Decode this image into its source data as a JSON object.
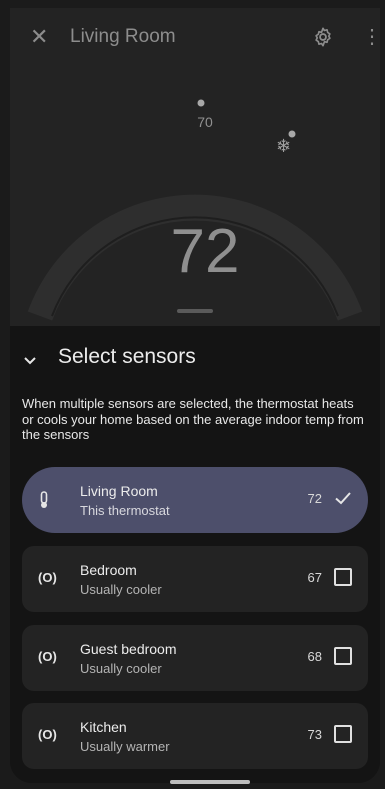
{
  "header": {
    "title": "Living Room",
    "close_icon": "close-icon",
    "settings_icon": "gear-icon",
    "more_icon": "more-vert-icon"
  },
  "thermostat": {
    "set_temp": "70",
    "current_temp": "72",
    "mode_icon": "snowflake-icon",
    "mode_glyph": "❄"
  },
  "sensors": {
    "title": "Select sensors",
    "description": "When multiple sensors are selected, the thermostat heats or cools your home based on the average indoor temp from the sensors",
    "items": [
      {
        "name": "Living Room",
        "subtitle": "This thermostat",
        "temp": "72",
        "selected": true,
        "icon": "thermometer-icon",
        "icon_glyph": "🌡"
      },
      {
        "name": "Bedroom",
        "subtitle": "Usually cooler",
        "temp": "67",
        "selected": false,
        "icon": "sensor-icon",
        "icon_glyph": "(O)"
      },
      {
        "name": "Guest bedroom",
        "subtitle": "Usually cooler",
        "temp": "68",
        "selected": false,
        "icon": "sensor-icon",
        "icon_glyph": "(O)"
      },
      {
        "name": "Kitchen",
        "subtitle": "Usually warmer",
        "temp": "73",
        "selected": false,
        "icon": "sensor-icon",
        "icon_glyph": "(O)"
      }
    ]
  },
  "colors": {
    "selected_card": "#4d4f6b",
    "card": "#232323",
    "background": "#141414"
  }
}
